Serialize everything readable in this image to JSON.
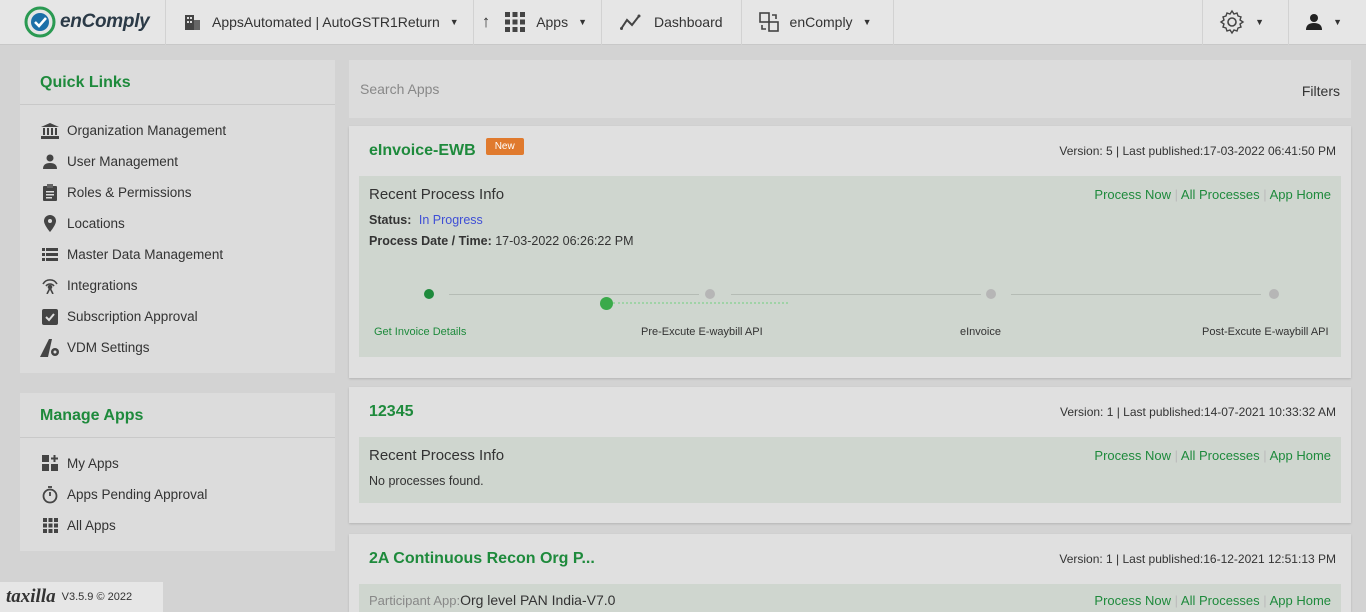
{
  "topbar": {
    "brand_name": "enComply",
    "org_selector": "AppsAutomated | AutoGSTR1Return",
    "apps_label": "Apps",
    "dashboard_label": "Dashboard",
    "product_label": "enComply"
  },
  "quick_links": {
    "title": "Quick Links",
    "items": [
      {
        "label": "Organization Management",
        "icon": "bank-icon"
      },
      {
        "label": "User Management",
        "icon": "user-icon"
      },
      {
        "label": "Roles & Permissions",
        "icon": "clipboard-icon"
      },
      {
        "label": "Locations",
        "icon": "map-pin-icon"
      },
      {
        "label": "Master Data Management",
        "icon": "list-grid-icon"
      },
      {
        "label": "Integrations",
        "icon": "signal-icon"
      },
      {
        "label": "Subscription Approval",
        "icon": "checkbox-icon"
      },
      {
        "label": "VDM Settings",
        "icon": "road-gear-icon"
      }
    ]
  },
  "manage_apps": {
    "title": "Manage Apps",
    "items": [
      {
        "label": "My Apps",
        "icon": "apps-plus-icon"
      },
      {
        "label": "Apps Pending Approval",
        "icon": "stopwatch-icon"
      },
      {
        "label": "All Apps",
        "icon": "grid-icon"
      }
    ]
  },
  "search": {
    "placeholder": "Search Apps",
    "filters_label": "Filters"
  },
  "apps": [
    {
      "title": "eInvoice-EWB",
      "badge": "New",
      "version": "Version: 5 | Last published:17-03-2022 06:41:50 PM",
      "process_title": "Recent Process Info",
      "links": {
        "process_now": "Process Now",
        "all_processes": "All Processes",
        "app_home": "App Home",
        "sep": "|"
      },
      "status_label": "Status:",
      "status_value": "In Progress",
      "date_label": "Process Date / Time:",
      "date_value": "17-03-2022 06:26:22 PM",
      "steps": [
        "Get Invoice Details",
        "Pre-Excute E-waybill API",
        "eInvoice",
        "Post-Excute E-waybill API"
      ]
    },
    {
      "title": "12345",
      "version": "Version: 1 | Last published:14-07-2021 10:33:32 AM",
      "process_title": "Recent Process Info",
      "links": {
        "process_now": "Process Now",
        "all_processes": "All Processes",
        "app_home": "App Home",
        "sep": "|"
      },
      "no_processes": "No processes found."
    },
    {
      "title": "2A Continuous Recon Org P...",
      "version": "Version: 1 | Last published:16-12-2021 12:51:13 PM",
      "participant_label": "Participant App:",
      "participant_value": "Org level PAN India-V7.0",
      "links": {
        "process_now": "Process Now",
        "all_processes": "All Processes",
        "app_home": "App Home",
        "sep": "|"
      }
    }
  ],
  "footer": {
    "logo": "taxilla",
    "version": "V3.5.9 © 2022"
  },
  "colors": {
    "brand_green": "#1e8a3c",
    "badge_orange": "#e07a2e",
    "status_blue": "#3f4fd6"
  }
}
